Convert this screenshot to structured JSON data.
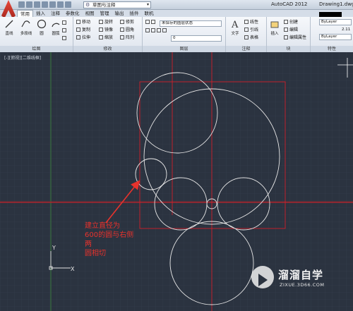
{
  "title_bar": {
    "workspace": "草图与注释",
    "app_name": "AutoCAD 2012",
    "document": "Drawing1.dwg"
  },
  "tabs": [
    "常用",
    "插入",
    "注释",
    "参数化",
    "视图",
    "管理",
    "输出",
    "插件",
    "联机"
  ],
  "ribbon": {
    "draw": {
      "title": "绘图",
      "line": "直线",
      "polyline": "多段线",
      "circle": "圆",
      "arc": "圆弧"
    },
    "modify": {
      "title": "修改",
      "move": "移动",
      "rotate": "旋转",
      "trim": "修剪",
      "copy": "复制",
      "mirror": "镜像",
      "fillet": "圆角",
      "stretch": "拉伸",
      "scale": "缩放",
      "array": "阵列"
    },
    "layers": {
      "title": "图层",
      "state": "未保存的图层状态",
      "current_layer": "0"
    },
    "annotation": {
      "title": "注释",
      "text": "文字",
      "dimension": "线性",
      "leader": "引线",
      "table": "表格"
    },
    "block": {
      "title": "块",
      "insert": "插入",
      "create": "创建",
      "edit": "编辑",
      "edit_attributes": "编辑属性"
    },
    "properties": {
      "title": "特性",
      "layer_prop": "ByLayer",
      "lineweight": "ByLayer",
      "value": "2.11"
    }
  },
  "viewport": {
    "label": "[-][俯视][二维线框]"
  },
  "annotation_text": [
    "建立直径为",
    "600的圆与右侧两",
    "圆相切"
  ],
  "watermark": {
    "name": "溜溜自学",
    "url": "ZIXUE.3D66.COM"
  },
  "colors": {
    "canvas": "#2b3340",
    "grid": "#3a4352",
    "red_lines": "#d0202a",
    "circles": "#e6e6e6",
    "arrow": "#e8322c"
  }
}
